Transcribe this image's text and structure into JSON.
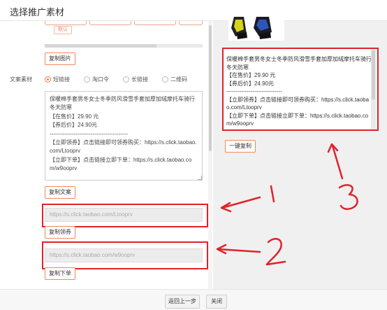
{
  "dialog": {
    "title": "选择推广素材"
  },
  "left": {
    "default_tag": "默认",
    "copy_image_button": "复制图片",
    "copy_label": "文案素材",
    "link_types": [
      {
        "label": "短链接",
        "selected": true
      },
      {
        "label": "淘口令",
        "selected": false
      },
      {
        "label": "长链接",
        "selected": false
      },
      {
        "label": "二维码",
        "selected": false
      }
    ],
    "textarea_lines": [
      "保暖棉手套男冬女士冬季防风滑雪手套加厚加绒摩托车骑行冬天防寒",
      "【在售价】29.90 元",
      "【券后价】24.90元",
      "------------------------------------------",
      "【立即领券】点击链接即可领券购买：https://s.click.taobao.com/Ltooprv",
      "【立即下单】点击链接立即下单：https://s.click.taobao.com/w9ooprv"
    ],
    "copy_text_button": "复制文案",
    "coupon_link": "https://s.click.taobao.com/Ltooprv",
    "copy_coupon_button": "复制领券",
    "order_link": "https://s.click.taobao.com/w9ooprv",
    "copy_order_button": "复制下单"
  },
  "right": {
    "preview_lines": [
      "保暖棉手套男冬女士冬季防风滑雪手套加厚加绒摩托车骑行冬天防寒",
      "【在售价】29.90 元",
      "【券后价】24.90元",
      "------------------------------",
      "【立即领券】点击链接即可领券购买：https://s.click.taobao.com/Ltooprv",
      "【立即下单】点击链接立即下单：https://s.click.taobao.com/w9ooprv"
    ],
    "one_click_copy_button": "一键复制"
  },
  "annotations": {
    "n1": "1",
    "n2": "2",
    "n3": "3",
    "color": "#e0222a"
  },
  "footer": {
    "back_button": "返回上一步",
    "close_button": "关闭"
  },
  "colors": {
    "accent": "#f07a4a",
    "annotation_red": "#e0222a"
  }
}
